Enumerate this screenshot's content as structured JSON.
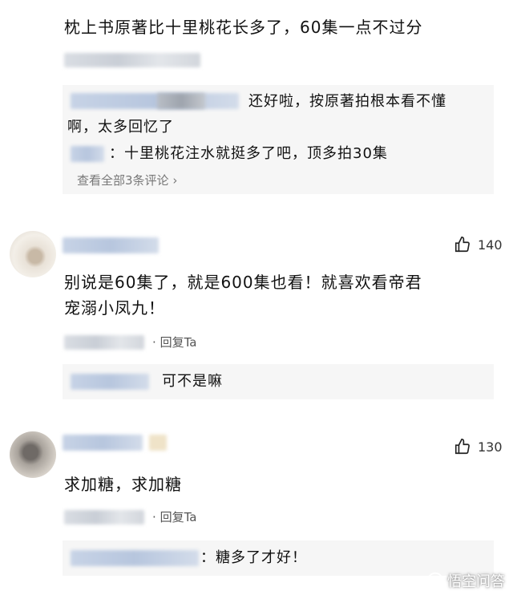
{
  "top_comment": {
    "text": "枕上书原著比十里桃花长多了，60集一点不过分",
    "replies": [
      {
        "text_cont": "还好啦，按原著拍根本看不懂",
        "text_line2": "啊，太多回忆了"
      },
      {
        "text": "：十里桃花注水就挺多了吧，顶多拍30集"
      }
    ],
    "view_all": "查看全部3条评论"
  },
  "comment2": {
    "text_line1": "别说是60集了，就是600集也看！就喜欢看帝君",
    "text_line2": "宠溺小凤九！",
    "likes": "140",
    "reply_label": "回复Ta",
    "reply": {
      "text": "可不是嘛"
    }
  },
  "comment3": {
    "text": "求加糖，求加糖",
    "likes": "130",
    "reply_label": "回复Ta",
    "reply": {
      "text": "：糖多了才好！"
    }
  },
  "watermark": {
    "text": "悟空问答"
  }
}
